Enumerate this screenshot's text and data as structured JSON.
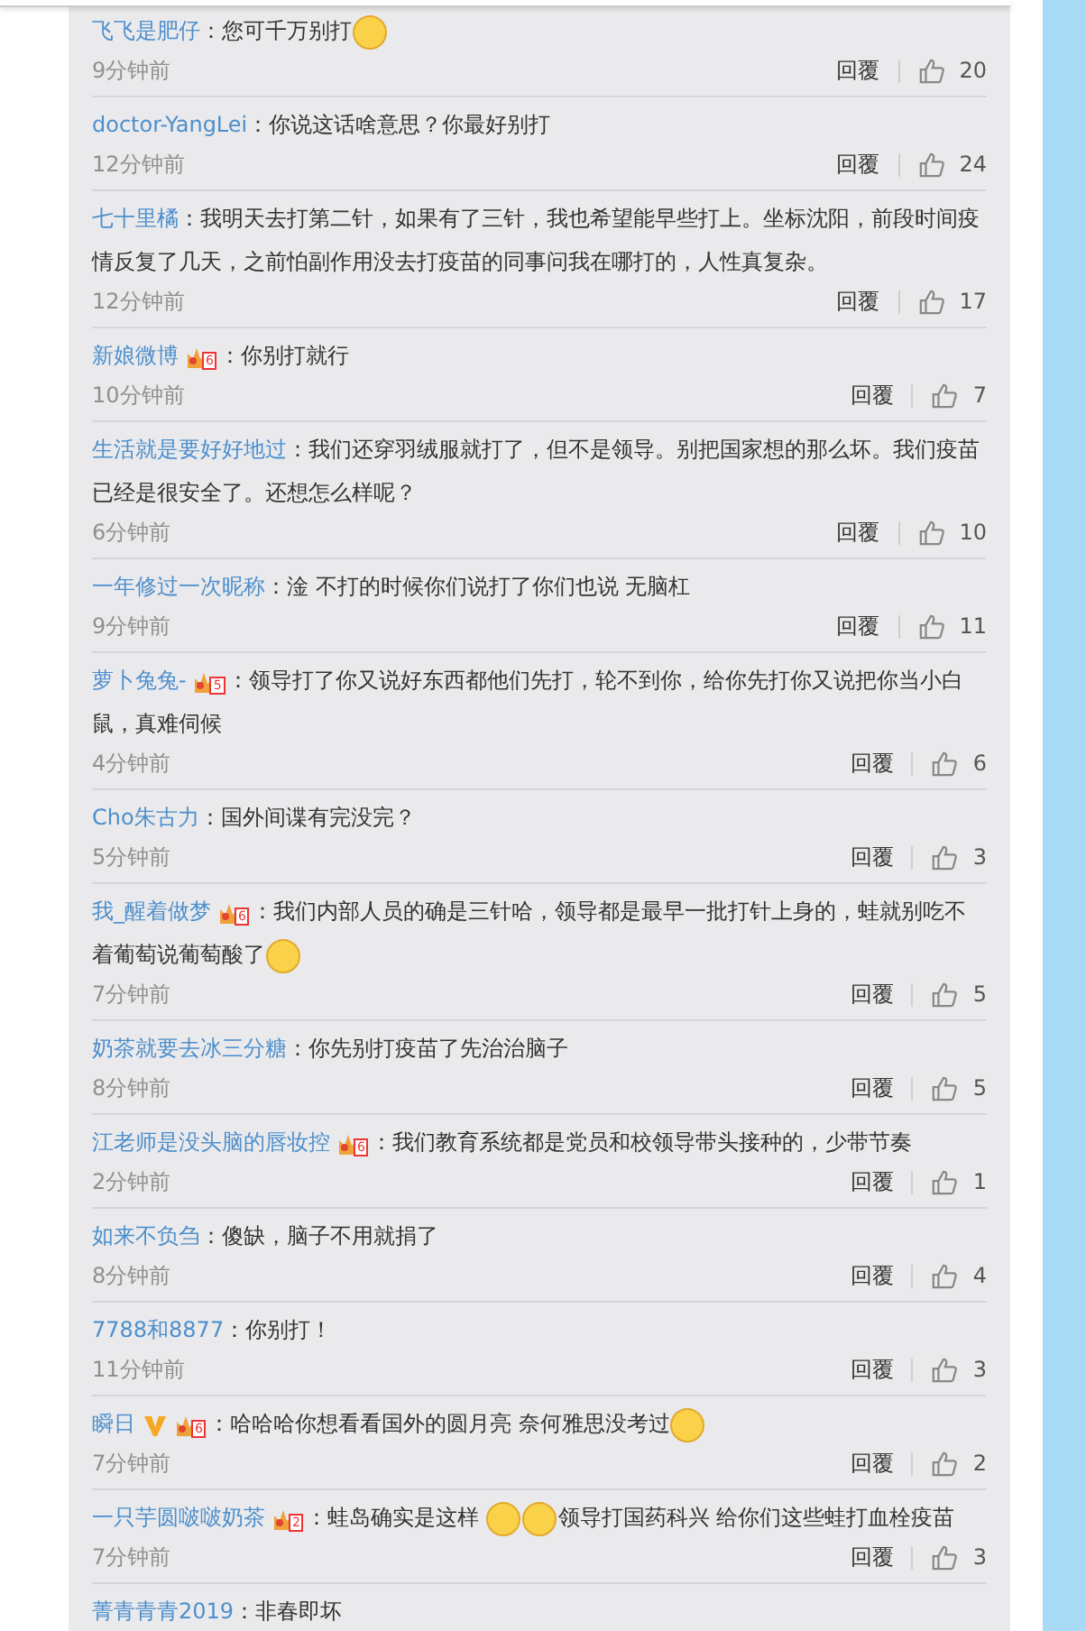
{
  "comments": [
    {
      "user": "飞飞是肥仔",
      "verified": false,
      "segments": [
        {
          "kind": "text",
          "text": "：您可千万别打"
        },
        {
          "kind": "emoji"
        }
      ],
      "time": "9分钟前",
      "reply": "回覆",
      "likes": "20"
    },
    {
      "user": "doctor-YangLei",
      "verified": false,
      "segments": [
        {
          "kind": "text",
          "text": "：你说这话啥意思？你最好别打"
        }
      ],
      "time": "12分钟前",
      "reply": "回覆",
      "likes": "24"
    },
    {
      "user": "七十里橘",
      "verified": false,
      "segments": [
        {
          "kind": "text",
          "text": "：我明天去打第二针，如果有了三针，我也希望能早些打上。坐标沈阳，前段时间疫情反复了几天，之前怕副作用没去打疫苗的同事问我在哪打的，人性真复杂。"
        }
      ],
      "time": "12分钟前",
      "reply": "回覆",
      "likes": "17"
    },
    {
      "user": "新娘微博",
      "badge": "6",
      "verified": false,
      "segments": [
        {
          "kind": "text",
          "text": "：你别打就行"
        }
      ],
      "time": "10分钟前",
      "reply": "回覆",
      "likes": "7"
    },
    {
      "user": "生活就是要好好地过",
      "verified": false,
      "segments": [
        {
          "kind": "text",
          "text": "：我们还穿羽绒服就打了，但不是领导。别把国家想的那么坏。我们疫苗已经是很安全了。还想怎么样呢？"
        }
      ],
      "time": "6分钟前",
      "reply": "回覆",
      "likes": "10"
    },
    {
      "user": "一年修过一次昵称",
      "verified": false,
      "segments": [
        {
          "kind": "text",
          "text": "：淦 不打的时候你们说打了你们也说 无脑杠"
        }
      ],
      "time": "9分钟前",
      "reply": "回覆",
      "likes": "11"
    },
    {
      "user": "萝卜兔兔-",
      "badge": "5",
      "verified": false,
      "segments": [
        {
          "kind": "text",
          "text": "：领导打了你又说好东西都他们先打，轮不到你，给你先打你又说把你当小白鼠，真难伺候"
        }
      ],
      "time": "4分钟前",
      "reply": "回覆",
      "likes": "6"
    },
    {
      "user": "Cho朱古力",
      "verified": false,
      "segments": [
        {
          "kind": "text",
          "text": "：国外间谍有完没完？"
        }
      ],
      "time": "5分钟前",
      "reply": "回覆",
      "likes": "3"
    },
    {
      "user": "我_醒着做梦",
      "badge": "6",
      "verified": false,
      "segments": [
        {
          "kind": "text",
          "text": "：我们内部人员的确是三针哈，领导都是最早一批打针上身的，蛙就别吃不着葡萄说葡萄酸了"
        },
        {
          "kind": "emoji"
        }
      ],
      "time": "7分钟前",
      "reply": "回覆",
      "likes": "5"
    },
    {
      "user": "奶茶就要去冰三分糖",
      "verified": false,
      "segments": [
        {
          "kind": "text",
          "text": "：你先别打疫苗了先治治脑子"
        }
      ],
      "time": "8分钟前",
      "reply": "回覆",
      "likes": "5"
    },
    {
      "user": "江老师是没头脑的唇妆控",
      "badge": "6",
      "verified": false,
      "segments": [
        {
          "kind": "text",
          "text": "：我们教育系统都是党员和校领导带头接种的，少带节奏"
        }
      ],
      "time": "2分钟前",
      "reply": "回覆",
      "likes": "1"
    },
    {
      "user": "如来不负刍",
      "verified": false,
      "segments": [
        {
          "kind": "text",
          "text": "：傻缺，脑子不用就捐了"
        }
      ],
      "time": "8分钟前",
      "reply": "回覆",
      "likes": "4"
    },
    {
      "user": "7788和8877",
      "verified": false,
      "segments": [
        {
          "kind": "text",
          "text": "：你别打！"
        }
      ],
      "time": "11分钟前",
      "reply": "回覆",
      "likes": "3"
    },
    {
      "user": "瞬日",
      "badge": "6",
      "verified": true,
      "segments": [
        {
          "kind": "text",
          "text": "：哈哈哈你想看看国外的圆月亮 奈何雅思没考过"
        },
        {
          "kind": "emoji"
        }
      ],
      "time": "7分钟前",
      "reply": "回覆",
      "likes": "2"
    },
    {
      "user": "一只芋圆啵啵奶茶",
      "badge": "2",
      "verified": false,
      "segments": [
        {
          "kind": "text",
          "text": "：蛙岛确实是这样 "
        },
        {
          "kind": "emoji"
        },
        {
          "kind": "emoji"
        },
        {
          "kind": "text",
          "text": "领导打国药科兴 给你们这些蛙打血栓疫苗"
        }
      ],
      "time": "7分钟前",
      "reply": "回覆",
      "likes": "3"
    },
    {
      "user": "菁青青青2019",
      "verified": false,
      "segments": [
        {
          "kind": "text",
          "text": "：非春即坏"
        }
      ]
    }
  ]
}
